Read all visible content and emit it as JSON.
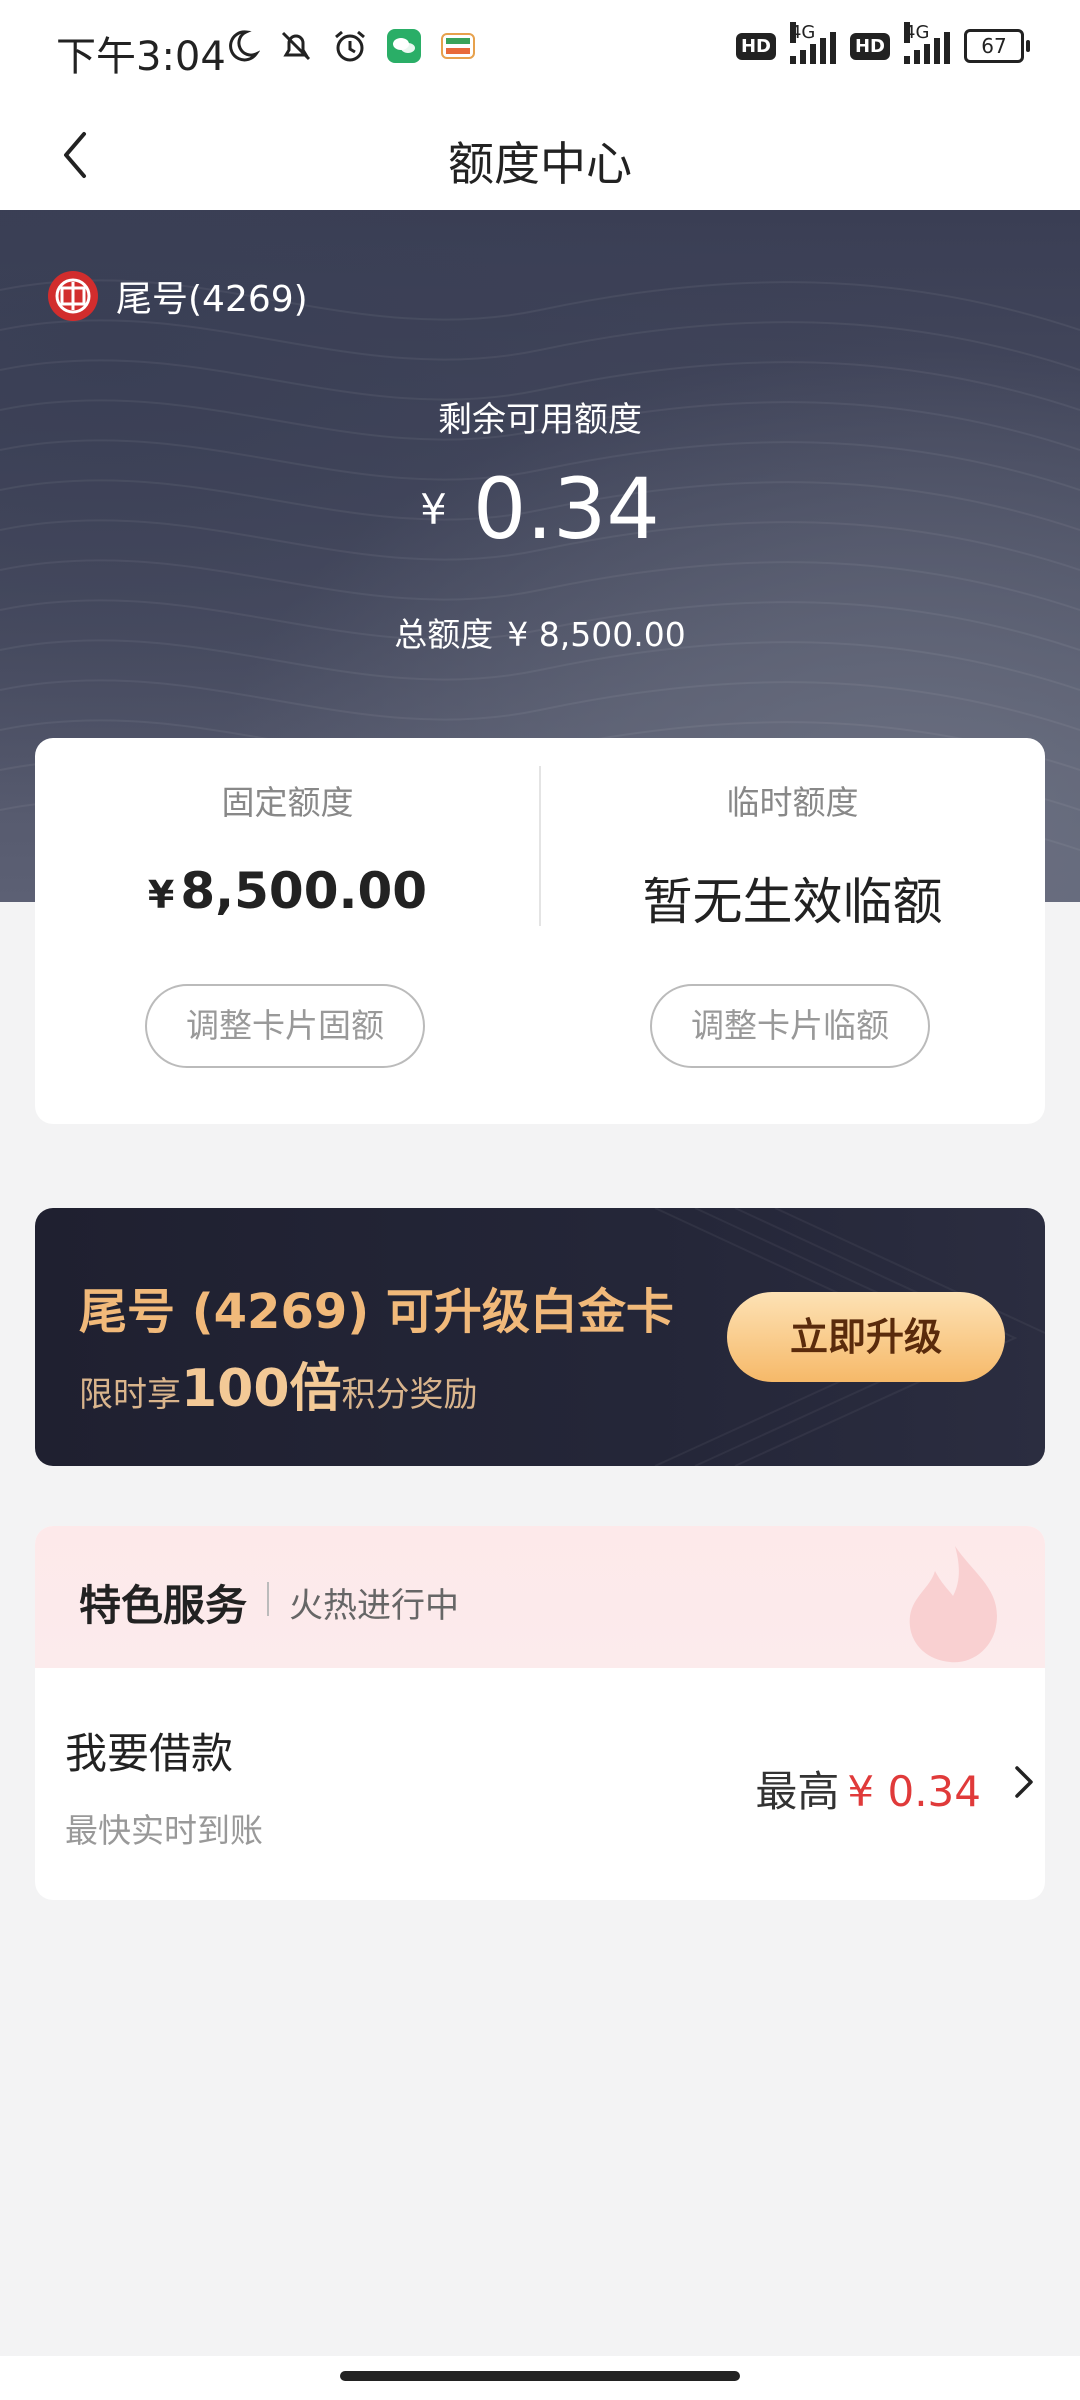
{
  "status_bar": {
    "time": "下午3:04",
    "battery": "67",
    "network": "4G"
  },
  "nav": {
    "title": "额度中心"
  },
  "card": {
    "tail_label": "尾号(4269)",
    "remaining_label": "剩余可用额度",
    "currency": "¥",
    "remaining_value": "0.34",
    "total_label": "总额度",
    "total_value": "¥ 8,500.00"
  },
  "quota": {
    "fixed_label": "固定额度",
    "fixed_currency": "¥",
    "fixed_value": "8,500.00",
    "fixed_button": "调整卡片固额",
    "temp_label": "临时额度",
    "temp_value": "暂无生效临额",
    "temp_button": "调整卡片临额"
  },
  "upgrade": {
    "title": "尾号 (4269) 可升级白金卡",
    "sub_prefix": "限时享",
    "sub_highlight": "100倍",
    "sub_suffix": "积分奖励",
    "button": "立即升级"
  },
  "features": {
    "title": "特色服务",
    "subtitle": "火热进行中",
    "loan_title": "我要借款",
    "loan_sub": "最快实时到账",
    "loan_max_label": "最高",
    "loan_max_value": "¥ 0.34"
  },
  "colors": {
    "accent_red": "#e03a3a",
    "gold": "#f1b97a",
    "hero_dark": "#3a3e54"
  }
}
